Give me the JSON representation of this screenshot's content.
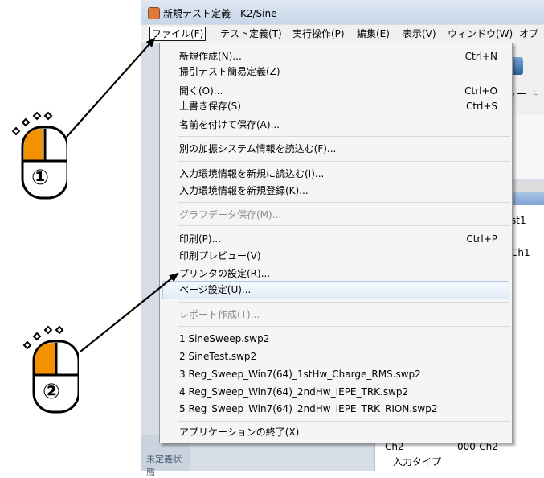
{
  "window": {
    "title": "新規テスト定義 - K2/Sine"
  },
  "menubar": {
    "items": [
      {
        "label": "ファイル(F)"
      },
      {
        "label": "テスト定義(T)"
      },
      {
        "label": "実行操作(P)"
      },
      {
        "label": "編集(E)"
      },
      {
        "label": "表示(V)"
      },
      {
        "label": "ウィンドウ(W)"
      },
      {
        "label": "オプ"
      }
    ]
  },
  "file_menu": {
    "items": [
      {
        "label": "新規作成(N)...",
        "shortcut": "Ctrl+N"
      },
      {
        "label": "掃引テスト簡易定義(Z)",
        "shortcut": ""
      },
      {
        "label": "開く(O)...",
        "shortcut": "Ctrl+O"
      },
      {
        "label": "上書き保存(S)",
        "shortcut": "Ctrl+S"
      },
      {
        "label": "名前を付けて保存(A)...",
        "shortcut": ""
      },
      {
        "label": "別の加振システム情報を読込む(F)...",
        "shortcut": ""
      },
      {
        "label": "入力環境情報を新規に読込む(I)...",
        "shortcut": ""
      },
      {
        "label": "入力環境情報を新規登録(K)...",
        "shortcut": ""
      },
      {
        "label": "グラフデータ保存(M)...",
        "shortcut": ""
      },
      {
        "label": "印刷(P)...",
        "shortcut": "Ctrl+P"
      },
      {
        "label": "印刷プレビュー(V)",
        "shortcut": ""
      },
      {
        "label": "プリンタの設定(R)...",
        "shortcut": ""
      },
      {
        "label": "ページ設定(U)...",
        "shortcut": ""
      },
      {
        "label": "レポート作成(T)...",
        "shortcut": ""
      },
      {
        "label": "1 SineSweep.swp2",
        "shortcut": ""
      },
      {
        "label": "2 SineTest.swp2",
        "shortcut": ""
      },
      {
        "label": "3 Reg_Sweep_Win7(64)_1stHw_Charge_RMS.swp2",
        "shortcut": ""
      },
      {
        "label": "4 Reg_Sweep_Win7(64)_2ndHw_IEPE_TRK.swp2",
        "shortcut": ""
      },
      {
        "label": "5 Reg_Sweep_Win7(64)_2ndHw_IEPE_TRK_RION.swp2",
        "shortcut": ""
      },
      {
        "label": "アプリケーションの終了(X)",
        "shortcut": ""
      }
    ],
    "disabled_items": [
      "グラフデータ保存(M)...",
      "レポート作成(T)..."
    ],
    "highlighted_item": "ページ設定(U)..."
  },
  "background": {
    "toolbar_label": "ュー",
    "toolbar_label2": "L",
    "panel_text_1": "st1",
    "panel_text_2": "Ch1",
    "panel_text_3": "Ch2",
    "panel_text_4": "000-Ch2",
    "panel_text_5": "入力タイプ",
    "status_text": "未定義状態"
  },
  "callouts": {
    "step1_label": "①",
    "step2_label": "②"
  },
  "colors": {
    "highlight": "#e3edf9",
    "mouse_button": "#f39200",
    "disabled_text": "#8c8c8c"
  }
}
